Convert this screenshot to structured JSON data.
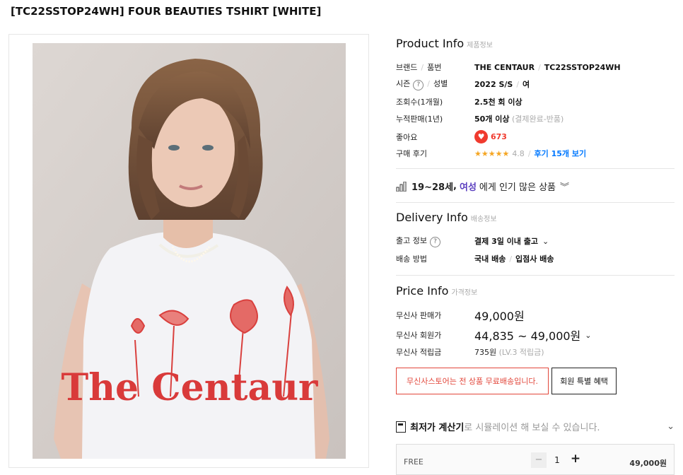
{
  "title": "[TC22SSTOP24WH] FOUR BEAUTIES TSHIRT [WHITE]",
  "product_info": {
    "heading": "Product Info",
    "heading_sub": "제품정보",
    "brand_label": "브랜드",
    "brand_label2": "품번",
    "brand": "THE CENTAUR",
    "sku": "TC22SSTOP24WH",
    "season_label": "시즌",
    "gender_label": "성별",
    "season": "2022 S/S",
    "gender": "여",
    "views_label": "조회수(1개월)",
    "views": "2.5천 회 이상",
    "sales_label": "누적판매(1년)",
    "sales": "50개 이상",
    "sales_note": "(결제완료-반품)",
    "likes_label": "좋아요",
    "likes": "673",
    "review_label": "구매 후기",
    "stars": "★★★★★",
    "rating": "4.8",
    "review_link": "후기 15개 보기"
  },
  "popular": {
    "age": "19~28세",
    "comma": ",",
    "gender": "여성",
    "text": "에게 인기 많은 상품"
  },
  "delivery": {
    "heading": "Delivery Info",
    "heading_sub": "배송정보",
    "ship_label": "출고 정보",
    "ship_value": "결제 3일 이내 출고",
    "method_label": "배송 방법",
    "method_a": "국내 배송",
    "method_b": "입점사 배송"
  },
  "price": {
    "heading": "Price Info",
    "heading_sub": "가격정보",
    "sale_label": "무신사 판매가",
    "sale": "49,000원",
    "member_label": "무신사 회원가",
    "member": "44,835 ~ 49,000원",
    "points_label": "무신사 적립금",
    "points": "735원",
    "points_note": "(LV.3 적립금)"
  },
  "buttons": {
    "free_ship": "무신사스토어는 전 상품 무료배송입니다.",
    "member_benefit": "회원 특별 혜택"
  },
  "calculator": {
    "bold": "최저가 계산기",
    "text": "로 시뮬레이션 해 보실 수 있습니다."
  },
  "option": {
    "size": "FREE",
    "qty": "1",
    "minus": "−",
    "plus": "+",
    "price": "49,000원"
  },
  "shirt_print": "The Centaur",
  "colors": {
    "accent_purple": "#5b3fbf",
    "review_blue": "#0078ff",
    "heart_red": "#f03a2e",
    "free_ship_red": "#e2463a"
  }
}
